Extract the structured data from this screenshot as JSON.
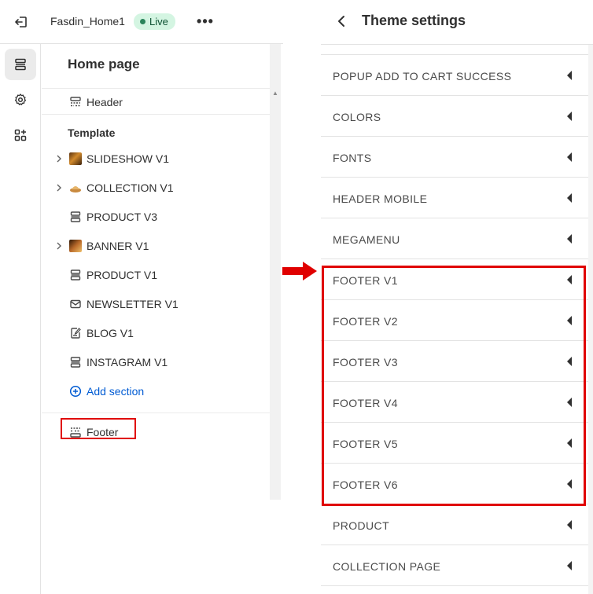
{
  "editor": {
    "theme_name": "Fasdin_Home1",
    "live_label": "Live",
    "more_label": "•••",
    "panel_title": "Home page",
    "header_label": "Header",
    "template_label": "Template",
    "sections": [
      {
        "label": "SLIDESHOW V1",
        "icon": "slideshow-thumbnail",
        "expandable": true
      },
      {
        "label": "COLLECTION V1",
        "icon": "collection-thumbnail",
        "expandable": true
      },
      {
        "label": "PRODUCT V3",
        "icon": "section-icon",
        "expandable": false
      },
      {
        "label": "BANNER V1",
        "icon": "banner-thumbnail",
        "expandable": true
      },
      {
        "label": "PRODUCT V1",
        "icon": "section-icon",
        "expandable": false
      },
      {
        "label": "NEWSLETTER V1",
        "icon": "envelope-icon",
        "expandable": false
      },
      {
        "label": "BLOG V1",
        "icon": "blog-icon",
        "expandable": false
      },
      {
        "label": "INSTAGRAM V1",
        "icon": "section-icon",
        "expandable": false
      }
    ],
    "add_section_label": "Add section",
    "footer_label": "Footer"
  },
  "settings": {
    "title": "Theme settings",
    "items": [
      "POPUP ADD TO CART SUCCESS",
      "COLORS",
      "FONTS",
      "HEADER MOBILE",
      "MEGAMENU",
      "FOOTER V1",
      "FOOTER V2",
      "FOOTER V3",
      "FOOTER V4",
      "FOOTER V5",
      "FOOTER V6",
      "PRODUCT",
      "COLLECTION PAGE"
    ]
  },
  "colors": {
    "highlight": "#e00000",
    "live_bg": "#d4f5e2",
    "link": "#005bd3"
  }
}
